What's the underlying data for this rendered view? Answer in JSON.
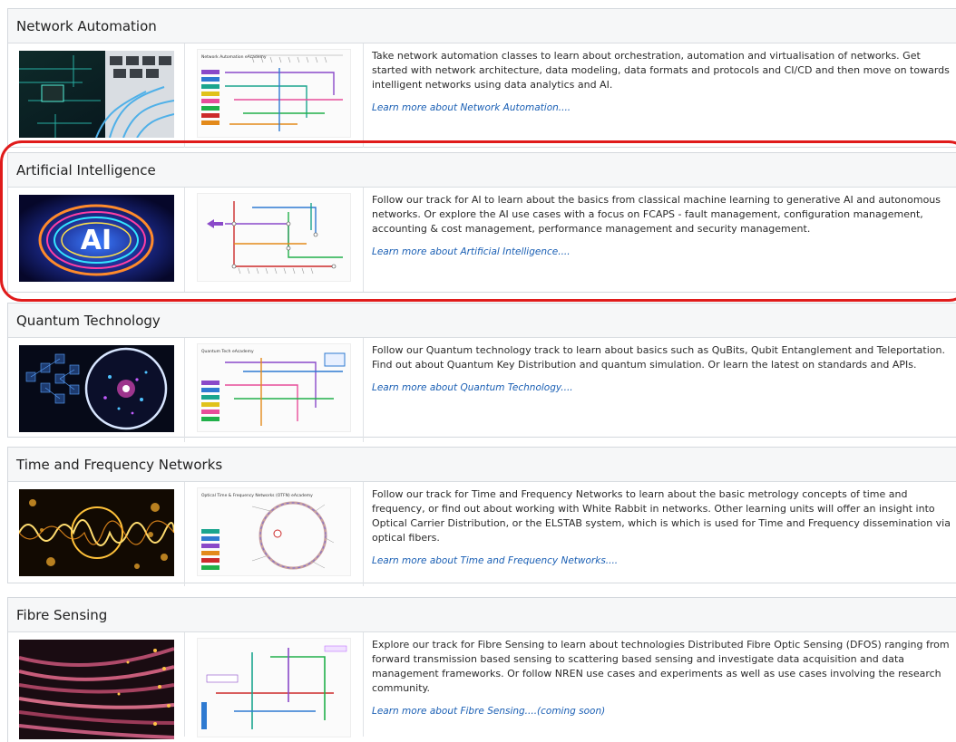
{
  "tracks": [
    {
      "title": "Network Automation",
      "description": "Take network automation classes to learn about orchestration, automation and virtualisation of networks. Get started with network architecture, data modeling, data formats and protocols and CI/CD and then move on towards intelligent networks using data analytics and AI.",
      "link": "Learn more about Network Automation....",
      "map_title": "Network Automation eAcademy",
      "photo_label": ""
    },
    {
      "title": "Artificial Intelligence",
      "description": "Follow our track for AI to learn about the basics from classical machine learning to generative AI and autonomous networks. Or explore the AI use cases with a focus on FCAPS - fault management, configuration management, accounting & cost management, performance management and security management.",
      "link": "Learn more about Artificial Intelligence....",
      "map_title": "",
      "photo_label": "AI"
    },
    {
      "title": "Quantum Technology",
      "description": "Follow our Quantum technology track to learn about basics such as QuBits, Qubit Entanglement and Teleportation. Find out about Quantum Key Distribution and quantum simulation. Or learn the latest on standards and APIs.",
      "link": "Learn more about Quantum Technology....",
      "map_title": "Quantum Tech eAcademy",
      "photo_label": ""
    },
    {
      "title": "Time and Frequency Networks",
      "description": "Follow our track for Time and Frequency Networks to learn about the basic metrology concepts of time and frequency, or find out about working with White Rabbit in networks. Other learning units will offer an insight into Optical Carrier Distribution, or the ELSTAB system, which is which is used for Time and Frequency dissemination via optical fibers.",
      "link": "Learn more about Time and Frequency Networks....",
      "map_title": "Optical Time & Frequency Networks (OTFN) eAcademy",
      "photo_label": ""
    },
    {
      "title": "Fibre Sensing",
      "description": "Explore our track for Fibre Sensing to learn about technologies Distributed Fibre Optic Sensing (DFOS) ranging from forward transmission based sensing to scattering based sensing and investigate data acquisition and data management frameworks. Or follow NREN use cases and experiments as well as use cases involving the research community.",
      "link": "Learn more about Fibre Sensing....(coming soon)",
      "map_title": "",
      "photo_label": ""
    }
  ],
  "colors": {
    "highlight": "#e01b1b",
    "link": "#1a5fb4",
    "header_bg": "#f6f7f8"
  }
}
